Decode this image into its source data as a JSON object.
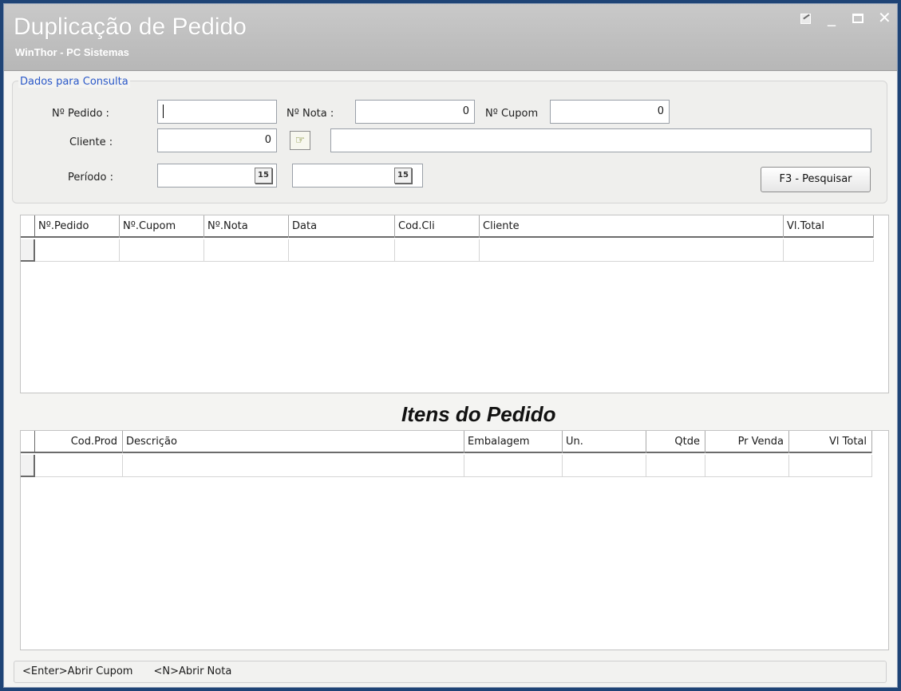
{
  "window": {
    "title": "Duplicação de Pedido",
    "subtitle": "WinThor - PC Sistemas"
  },
  "query": {
    "group_title": "Dados para Consulta",
    "pedido_label": "Nº Pedido :",
    "pedido_value": "",
    "nota_label": "Nº Nota :",
    "nota_value": "0",
    "cupom_label": "Nº Cupom",
    "cupom_value": "0",
    "cliente_label": "Cliente :",
    "cliente_code": "0",
    "cliente_name": "",
    "periodo_label": "Período :",
    "periodo_start": "",
    "periodo_end": "",
    "date_icon": "15",
    "search_button": "F3 - Pesquisar"
  },
  "orders_grid": {
    "columns": [
      "Nº.Pedido",
      "Nº.Cupom",
      "Nº.Nota",
      "Data",
      "Cod.Cli",
      "Cliente",
      "Vl.Total"
    ]
  },
  "items_section": {
    "title": "Itens do Pedido",
    "columns": [
      "Cod.Prod",
      "Descrição",
      "Embalagem",
      "Un.",
      "Qtde",
      "Pr Venda",
      "Vl Total"
    ]
  },
  "status": {
    "hint1": "<Enter>Abrir Cupom",
    "hint2": "<N>Abrir Nota"
  },
  "icons": {
    "search_icon": "hand-pointer-icon"
  }
}
